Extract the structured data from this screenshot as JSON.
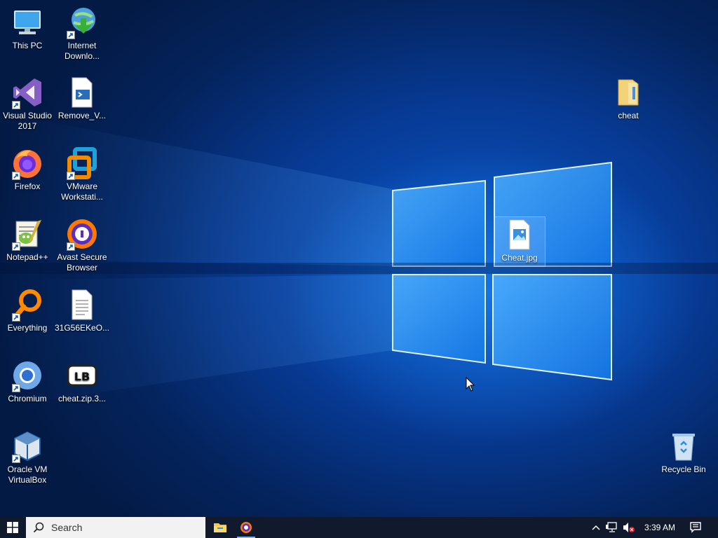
{
  "desktop": {
    "icons": [
      {
        "label": "This PC",
        "icon": "this-pc-icon"
      },
      {
        "label": "Internet Downlo...",
        "icon": "internet-download-manager-icon"
      },
      {
        "label": "Visual Studio 2017",
        "icon": "visual-studio-icon"
      },
      {
        "label": "Remove_V...",
        "icon": "script-file-icon"
      },
      {
        "label": "Firefox",
        "icon": "firefox-icon"
      },
      {
        "label": "VMware Workstati...",
        "icon": "vmware-icon"
      },
      {
        "label": "Notepad++",
        "icon": "notepad-plus-plus-icon"
      },
      {
        "label": "Avast Secure Browser",
        "icon": "avast-browser-icon"
      },
      {
        "label": "Everything",
        "icon": "everything-search-icon"
      },
      {
        "label": "31G56EKeO...",
        "icon": "text-file-icon"
      },
      {
        "label": "Chromium",
        "icon": "chromium-icon"
      },
      {
        "label": "cheat.zip.3...",
        "icon": "archive-file-icon"
      },
      {
        "label": "Oracle VM VirtualBox",
        "icon": "virtualbox-icon"
      },
      {
        "label": "cheat",
        "icon": "folder-icon"
      },
      {
        "label": "Cheat.jpg",
        "icon": "image-file-icon"
      },
      {
        "label": "Recycle Bin",
        "icon": "recycle-bin-icon"
      }
    ]
  },
  "taskbar": {
    "search_placeholder": "Search",
    "pinned": [
      {
        "name": "File Explorer",
        "icon": "folder-icon"
      },
      {
        "name": "Avast Secure Browser",
        "icon": "avast-browser-icon"
      }
    ],
    "clock": "3:39 AM"
  },
  "colors": {
    "taskbar": "#101a2c",
    "desktop_accent": "#0a58c8",
    "selection": "#a0c8ff"
  }
}
